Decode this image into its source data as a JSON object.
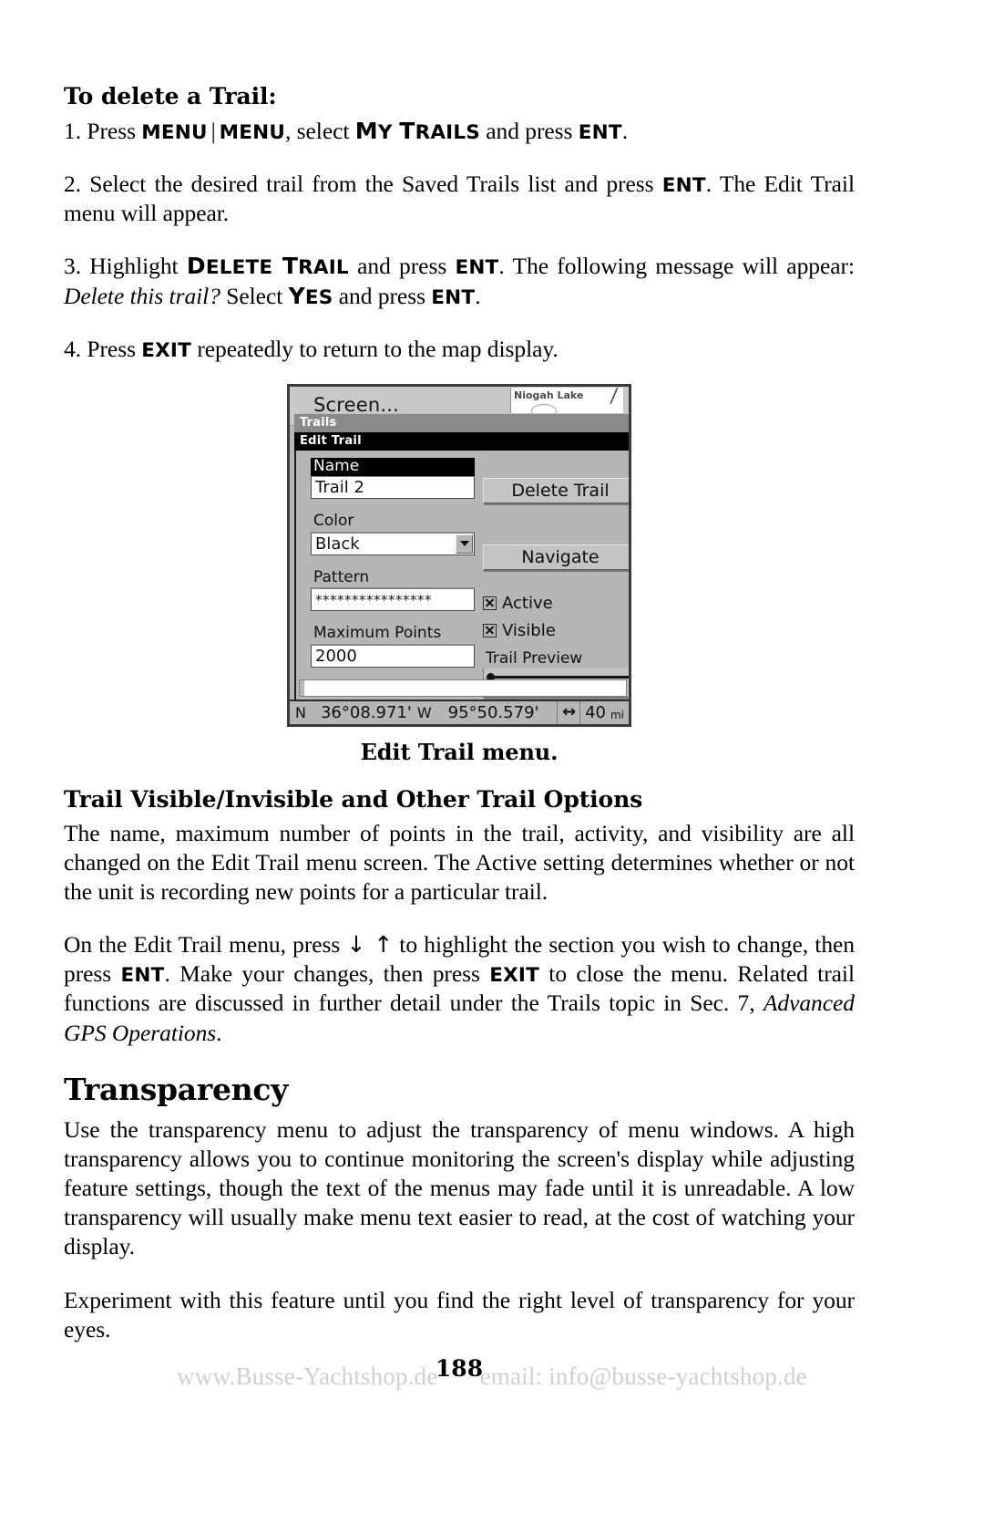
{
  "document": {
    "page_number": "188",
    "footer": {
      "website": "www.Busse-Yachtshop.de",
      "email": "email: info@busse-yachtshop.de"
    }
  },
  "sections": {
    "delete_trail": {
      "heading": "To delete a Trail:",
      "steps": [
        {
          "prefix": "1. Press ",
          "kbd1": "MENU",
          "sep": "|",
          "kbd2": "MENU",
          "mid": ", select ",
          "sc1_cap": "M",
          "sc1_rest": "Y",
          "sc1_cap2": "T",
          "sc1_rest2": "RAILS",
          "mid2": " and press ",
          "kbd3": "ENT",
          "suffix": "."
        }
      ],
      "step2_a": "2. Select the desired trail from the Saved Trails list and press ",
      "step2_kbd": "ENT",
      "step2_b": ". The Edit Trail menu will appear.",
      "step3_a": "3. Highlight ",
      "step3_sc_cap": "D",
      "step3_sc_rest": "ELETE",
      "step3_sc_cap2": "T",
      "step3_sc_rest2": "RAIL",
      "step3_b": " and press ",
      "step3_kbd": "ENT",
      "step3_c": ". The following message will appear: ",
      "step3_italic": "Delete this trail?",
      "step3_d": " Select ",
      "step3_sc_yes_cap": "Y",
      "step3_sc_yes_rest": "ES",
      "step3_e": " and press ",
      "step3_kbd2": "ENT",
      "step3_f": ".",
      "step4_a": "4. Press ",
      "step4_kbd": "EXIT",
      "step4_b": " repeatedly to return to the map display."
    },
    "figure": {
      "caption": "Edit Trail menu.",
      "device": {
        "screen_button": "Screen...",
        "map_lake_label": "Niogah Lake",
        "breadcrumb_trails": "Trails",
        "title_bar": "Edit Trail",
        "fields": {
          "name_label": "Name",
          "name_value": "Trail 2",
          "color_label": "Color",
          "color_value": "Black",
          "pattern_label": "Pattern",
          "pattern_value": "****************",
          "max_points_label": "Maximum Points",
          "max_points_value": "2000"
        },
        "buttons": {
          "delete_trail": "Delete Trail",
          "navigate": "Navigate"
        },
        "checkboxes": [
          {
            "label": "Active",
            "checked": true
          },
          {
            "label": "Visible",
            "checked": true
          }
        ],
        "trail_preview_label": "Trail Preview",
        "status": {
          "lat_hemisphere": "N",
          "latitude": "36°08.971'",
          "lon_hemisphere": "W",
          "longitude": "95°50.579'",
          "scale_icon": "↔",
          "scale_value": "40",
          "scale_unit": "mi"
        }
      }
    },
    "trail_options": {
      "heading": "Trail Visible/Invisible and Other Trail Options",
      "paragraph1": "The name, maximum number of points in the trail, activity, and visibility are all changed on the Edit Trail menu screen. The Active setting determines whether or not the unit is recording new points for a particular trail.",
      "p2_a": "On the Edit Trail menu, press ",
      "p2_arrows": "↓ ↑",
      "p2_b": " to highlight the section you wish to change, then press ",
      "p2_kbd1": "ENT",
      "p2_c": ". Make your changes, then press ",
      "p2_kbd2": "EXIT",
      "p2_d": " to close the menu. Related trail functions are discussed in further detail under the Trails topic in Sec. 7, ",
      "p2_italic": "Advanced GPS Operations",
      "p2_e": "."
    },
    "transparency": {
      "heading": "Transparency",
      "paragraph1": "Use the transparency menu to adjust the transparency of menu windows. A high transparency allows you to continue monitoring the screen's display while adjusting feature settings, though the text of the menus may fade until it is unreadable. A low transparency will usually make menu text easier to read, at the cost of watching your display.",
      "paragraph2": "Experiment with this feature until you find the right level of transparency for your eyes."
    }
  }
}
